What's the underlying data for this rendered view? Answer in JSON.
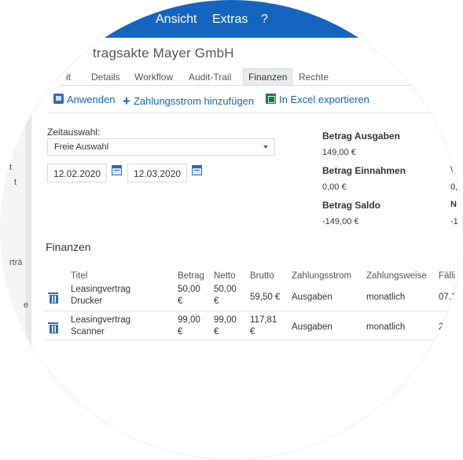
{
  "menu": {
    "items": [
      "Ansicht",
      "Extras",
      "?"
    ]
  },
  "sidebar": {
    "labels": [
      "t",
      "t",
      "rträ",
      "e"
    ]
  },
  "title": "tragsakte Mayer GmbH",
  "tabs": [
    {
      "label": "it",
      "active": false
    },
    {
      "label": "Details",
      "active": false
    },
    {
      "label": "Workflow",
      "active": false
    },
    {
      "label": "Audit-Trail",
      "active": false
    },
    {
      "label": "Finanzen",
      "active": true
    },
    {
      "label": "Rechte",
      "active": false
    }
  ],
  "toolbar": {
    "apply": "Anwenden",
    "add_stream": "Zahlungsstrom hinzufügen",
    "export": "In Excel exportieren"
  },
  "form": {
    "zeit_label": "Zeitauswahl:",
    "zeit_value": "Freie Auswahl",
    "date_from": "12.02.2020",
    "date_to": "12.03.2020"
  },
  "amounts": {
    "ausgaben_label": "Betrag Ausgaben",
    "ausgaben_value": "149,00 €",
    "einnahmen_label": "Betrag Einnahmen",
    "einnahmen_value": "0,00 €",
    "saldo_label": "Betrag Saldo",
    "saldo_value": "-149,00 €",
    "side_label_1": "\\",
    "side_value_1": "0,",
    "side_label_2": "N",
    "side_value_2": "-1"
  },
  "section_title": "Finanzen",
  "table": {
    "headers": [
      "Titel",
      "Betrag",
      "Netto",
      "Brutto",
      "Zahlungsstrom",
      "Zahlungsweise",
      "Fälli"
    ],
    "rows": [
      {
        "titel_1": "Leasingvertrag",
        "titel_2": "Drucker",
        "betrag_1": "50,00",
        "betrag_2": "€",
        "netto_1": "50,00",
        "netto_2": "€",
        "brutto": "59,50 €",
        "strom": "Ausgaben",
        "weise": "monatlich",
        "faellig": "07.1"
      },
      {
        "titel_1": "Leasingvertrag",
        "titel_2": "Scanner",
        "betrag_1": "99,00",
        "betrag_2": "€",
        "netto_1": "99,00",
        "netto_2": "€",
        "brutto_1": "117,81",
        "brutto_2": "€",
        "strom": "Ausgaben",
        "weise": "monatlich",
        "faellig": "2"
      }
    ]
  },
  "colors": {
    "menubar": "#1565c0",
    "accent": "#1565c0",
    "icon_blue": "#2f6bb6"
  }
}
